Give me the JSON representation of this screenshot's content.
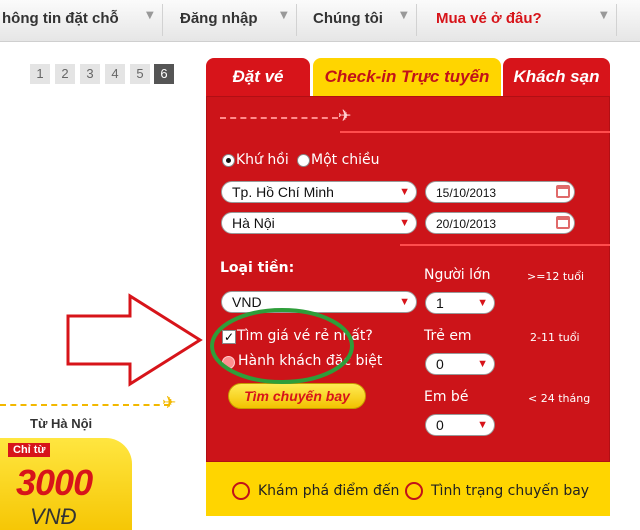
{
  "nav": {
    "items": [
      {
        "label": "hông tin đặt chỗ"
      },
      {
        "label": "Đăng nhập"
      },
      {
        "label": "Chúng tôi"
      },
      {
        "label": "Mua vé ở đâu?"
      }
    ]
  },
  "pager": [
    "1",
    "2",
    "3",
    "4",
    "5",
    "6"
  ],
  "promo": {
    "from_label": "Từ Hà Nội",
    "price_from": "Chỉ từ",
    "price": "3000",
    "currency": "VNĐ"
  },
  "tabs": {
    "booking": "Đặt vé",
    "checkin": "Check-in Trực tuyến",
    "hotel": "Khách sạn"
  },
  "form": {
    "round_trip": "Khứ hồi",
    "one_way": "Một chiều",
    "origin": "Tp. Hồ Chí Minh",
    "destination": "Hà Nội",
    "depart_date": "15/10/2013",
    "return_date": "20/10/2013",
    "currency_label": "Loại tiền:",
    "currency_value": "VND",
    "cheapest_label": "Tìm giá vé rẻ nhất?",
    "special_label": "Hành khách đặc biệt",
    "search_button": "Tìm chuyến bay",
    "adult_label": "Người lớn",
    "adult_age": ">=12 tuổi",
    "adult_count": "1",
    "child_label": "Trẻ em",
    "child_age": "2-11 tuổi",
    "child_count": "0",
    "infant_label": "Em bé",
    "infant_age": "< 24 tháng",
    "infant_count": "0"
  },
  "footer": {
    "explore": "Khám phá điểm đến",
    "flight_status": "Tình trạng chuyến bay"
  },
  "colors": {
    "brand_red": "#d7141a",
    "brand_yellow": "#ffd500",
    "annotation_green": "#2e9e3a"
  }
}
